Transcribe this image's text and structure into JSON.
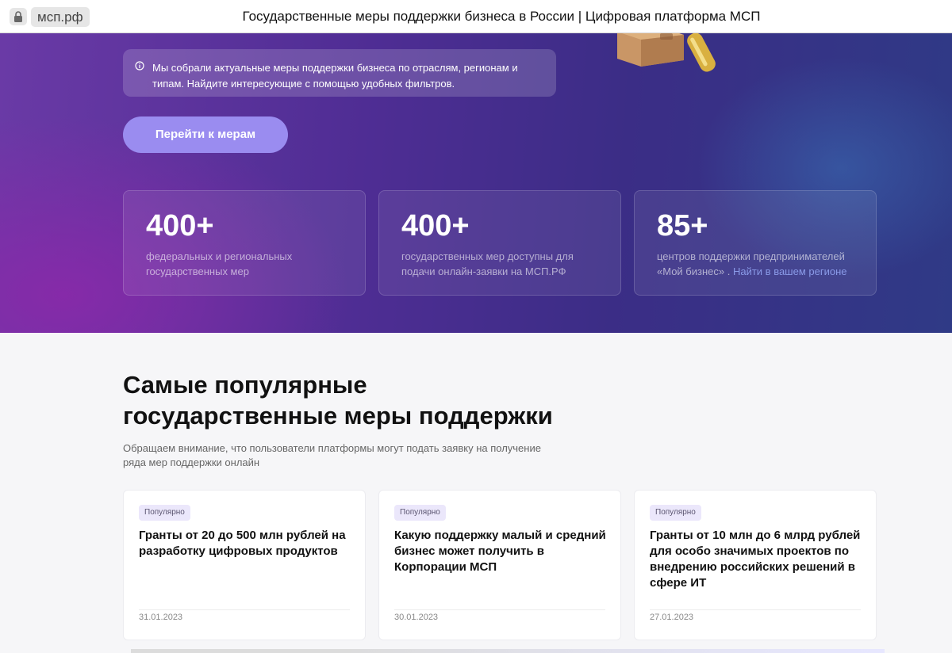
{
  "browser": {
    "url": "мсп.рф",
    "title": "Государственные меры поддержки бизнеса в России | Цифровая платформа МСП"
  },
  "hero": {
    "info": "Мы собрали актуальные меры поддержки бизнеса по отраслям, регионам и типам. Найдите интересующие с помощью удобных фильтров.",
    "cta": "Перейти к мерам",
    "stats": [
      {
        "value": "400+",
        "desc": "федеральных и региональных государственных мер"
      },
      {
        "value": "400+",
        "desc": "государственных мер доступны для подачи онлайн-заявки на МСП.РФ"
      },
      {
        "value": "85+",
        "desc": "центров поддержки предпринимателей «Мой бизнес» .",
        "link": "Найти в вашем регионе"
      }
    ]
  },
  "popular": {
    "title_line1": "Самые популярные",
    "title_line2": "государственные меры поддержки",
    "subtitle_line1": "Обращаем внимание, что пользователи платформы могут подать заявку на получение",
    "subtitle_line2": "ряда мер поддержки онлайн",
    "cards": [
      {
        "badge": "Популярно",
        "title": "Гранты от 20 до 500 млн рублей на разработку цифровых продуктов",
        "date": "31.01.2023"
      },
      {
        "badge": "Популярно",
        "title": "Какую поддержку малый и средний бизнес может получить в Корпорации МСП",
        "date": "30.01.2023"
      },
      {
        "badge": "Популярно",
        "title": "Гранты от 10 млн до 6 млрд рублей для особо значимых проектов по внедрению российских решений в сфере ИТ",
        "date": "27.01.2023"
      }
    ]
  },
  "colors": {
    "accent_button": "#9a8cf0",
    "hero_purple": "#6a3aa6",
    "hero_blue": "#2f3a86",
    "badge_bg": "#ebe7fb"
  },
  "icons": [
    "lock-icon",
    "info-icon",
    "decorative-illustration"
  ]
}
